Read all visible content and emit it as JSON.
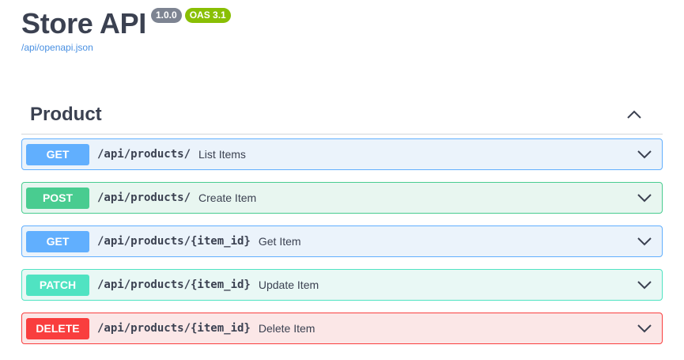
{
  "header": {
    "title": "Store API",
    "version_badge": "1.0.0",
    "oas_badge": "OAS 3.1",
    "spec_link": "/api/openapi.json"
  },
  "section": {
    "title": "Product",
    "toggle_icon": "chevron-up-icon"
  },
  "operations": [
    {
      "method": "GET",
      "path": "/api/products/",
      "summary": "List Items",
      "color": "#61affe",
      "bg": "#ebf3fb",
      "border": "#61affe"
    },
    {
      "method": "POST",
      "path": "/api/products/",
      "summary": "Create Item",
      "color": "#49cc90",
      "bg": "#e8f6f0",
      "border": "#49cc90"
    },
    {
      "method": "GET",
      "path": "/api/products/{item_id}",
      "summary": "Get Item",
      "color": "#61affe",
      "bg": "#ebf3fb",
      "border": "#61affe"
    },
    {
      "method": "PATCH",
      "path": "/api/products/{item_id}",
      "summary": "Update Item",
      "color": "#50e3c2",
      "bg": "#e9f8f5",
      "border": "#50e3c2"
    },
    {
      "method": "DELETE",
      "path": "/api/products/{item_id}",
      "summary": "Delete Item",
      "color": "#f93e3e",
      "bg": "#fbe7e7",
      "border": "#f93e3e"
    }
  ]
}
